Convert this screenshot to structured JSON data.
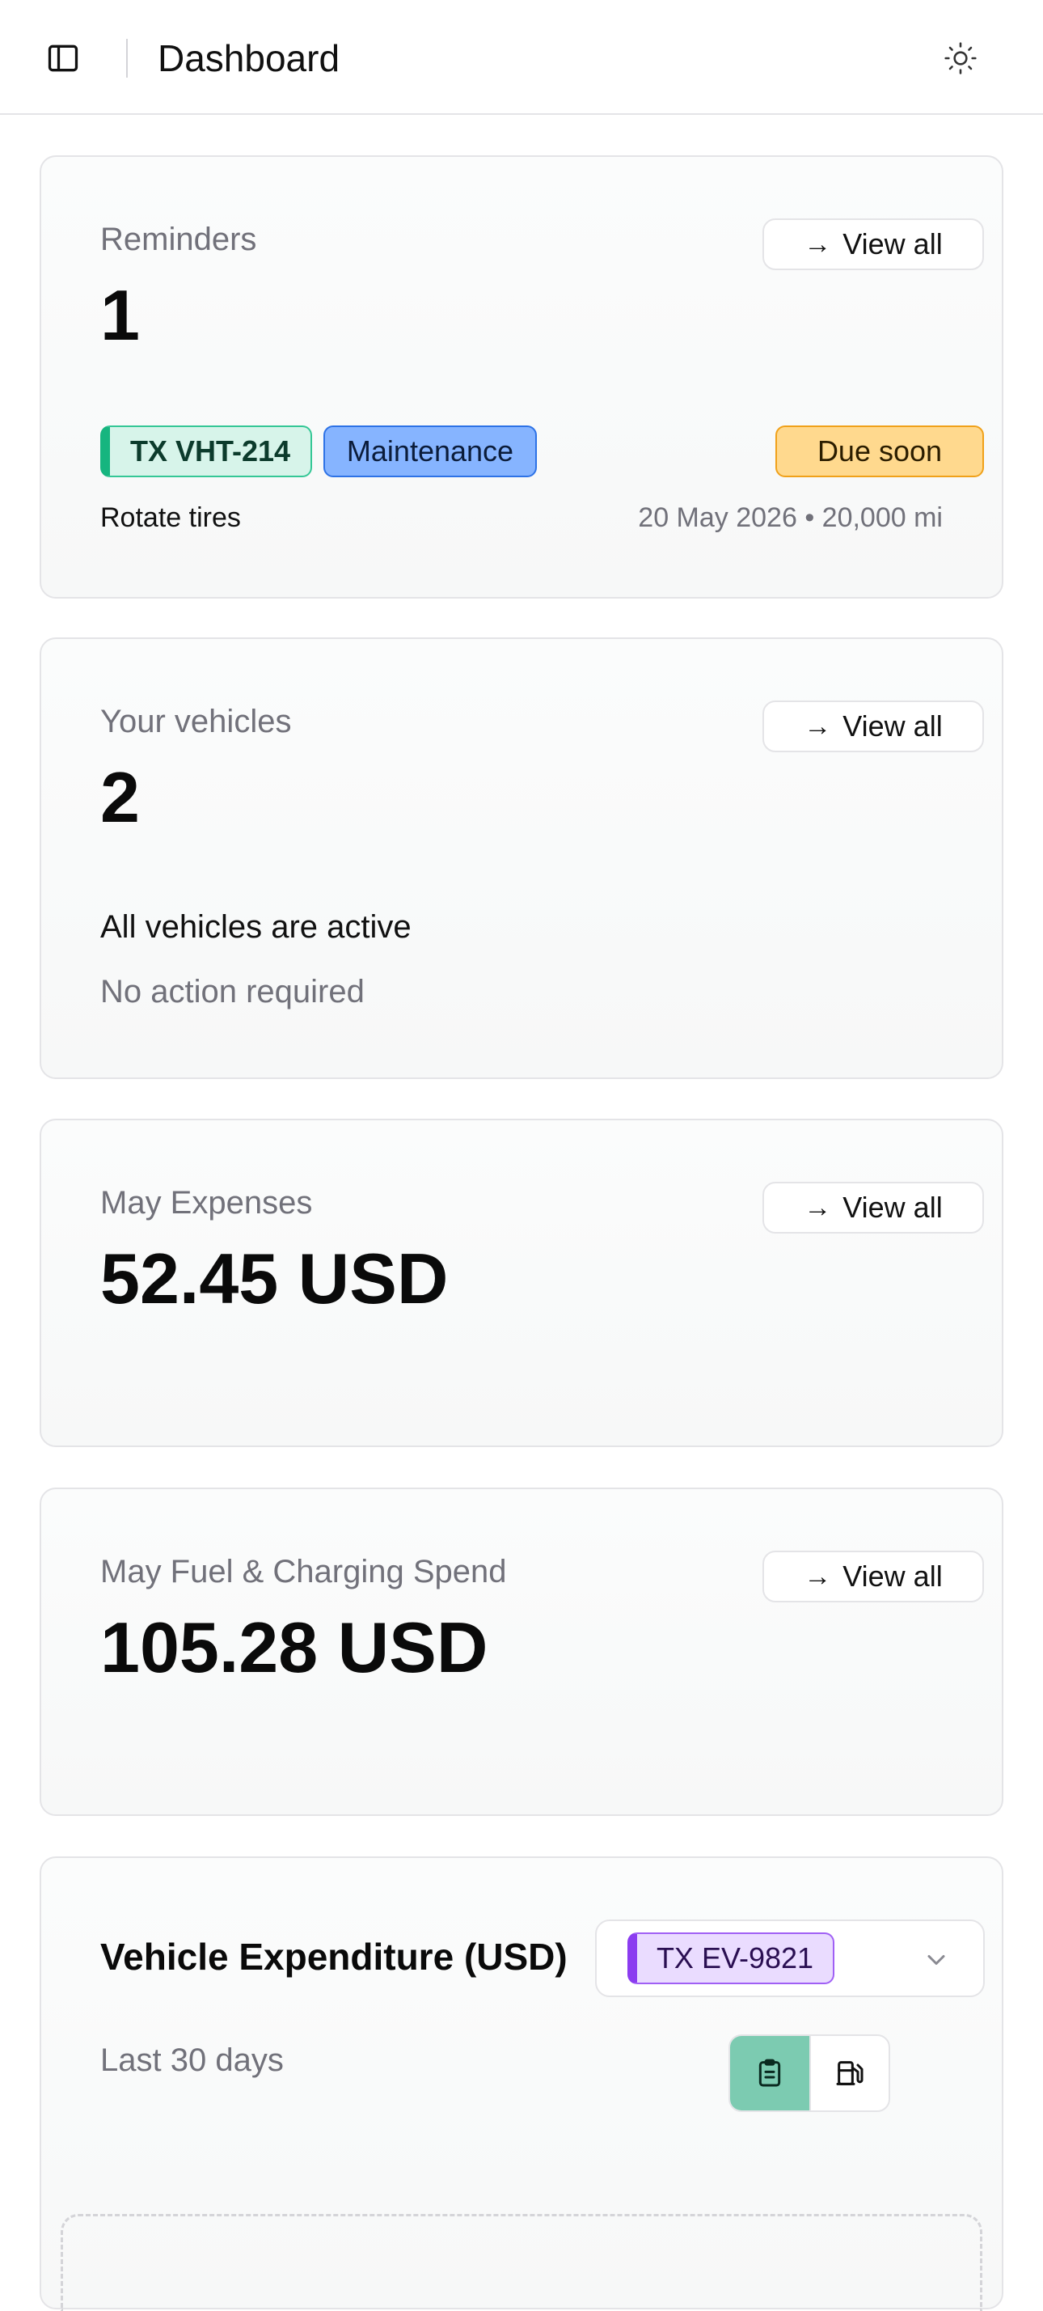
{
  "header": {
    "title": "Dashboard",
    "sidebar_toggle_icon": "sidebar-panel-icon",
    "theme_toggle_icon": "sun-icon"
  },
  "reminders_card": {
    "label": "Reminders",
    "count": "1",
    "view_all": "View all",
    "plate": "TX VHT-214",
    "category": "Maintenance",
    "status": "Due soon",
    "title": "Rotate tires",
    "meta": "20 May 2026 • 20,000 mi"
  },
  "vehicles_card": {
    "label": "Your vehicles",
    "count": "2",
    "view_all": "View all",
    "status": "All vehicles are active",
    "note": "No action required"
  },
  "expenses_card": {
    "label": "May Expenses",
    "value": "52.45 USD",
    "view_all": "View all"
  },
  "fuel_card": {
    "label": "May Fuel & Charging Spend",
    "value": "105.28 USD",
    "view_all": "View all"
  },
  "expenditure_card": {
    "title": "Vehicle Expenditure (USD)",
    "selected_vehicle": "TX EV-9821",
    "range": "Last 30 days",
    "toggle_options": [
      "clipboard-icon",
      "fuel-pump-icon"
    ],
    "active_toggle": "clipboard-icon"
  },
  "colors": {
    "accent_green": "#7ccbb1",
    "plate_green": "#16b57f",
    "category_blue": "#86b4ff",
    "status_amber": "#ffd98e",
    "ev_purple": "#8b3cf0",
    "muted_text": "#71717a"
  }
}
